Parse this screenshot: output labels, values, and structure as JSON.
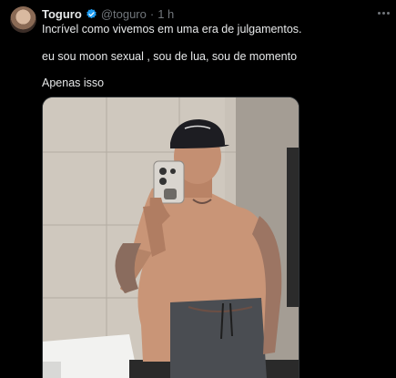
{
  "tweet": {
    "author_name": "Toguro",
    "handle": "@toguro",
    "separator": "·",
    "time": "1 h",
    "lines": [
      "Incrível como vivemos em uma era de julgamentos.",
      "eu sou moon sexual , sou de lua, sou de momento",
      "Apenas isso"
    ]
  },
  "icons": {
    "verified": "verified-badge-icon",
    "more": "more-options-icon"
  },
  "colors": {
    "background": "#000000",
    "text": "#e7e9ea",
    "muted": "#71767b",
    "verified": "#1d9bf0"
  }
}
